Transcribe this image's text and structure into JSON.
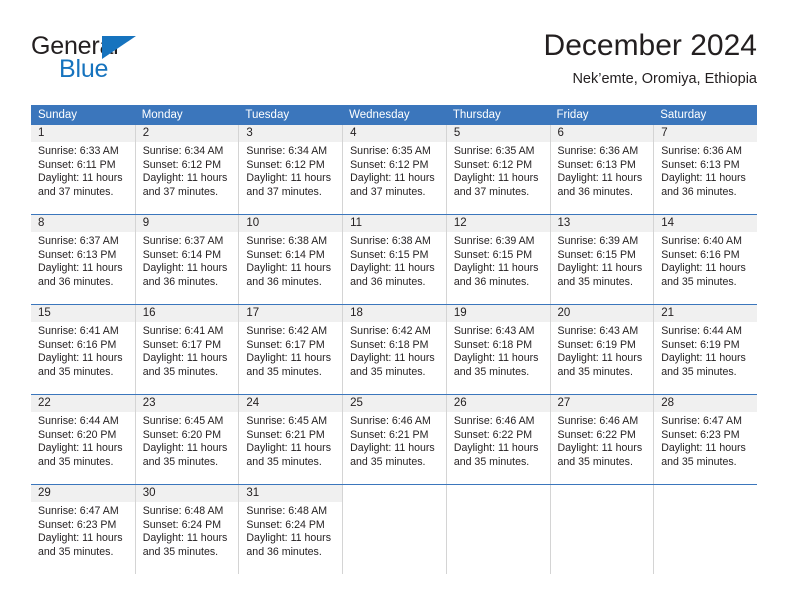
{
  "brand": {
    "name_part1": "General",
    "name_part2": "Blue",
    "triangle_color": "#1673be",
    "text_color": "#231f20"
  },
  "header": {
    "title": "December 2024",
    "subtitle": "Nek’emte, Oromiya, Ethiopia"
  },
  "theme": {
    "header_bg": "#3b76bc",
    "header_text": "#ffffff",
    "daynum_bg": "#f0f0f0",
    "cell_border": "#d4d4d4",
    "text": "#231f20"
  },
  "weekday_headers": [
    "Sunday",
    "Monday",
    "Tuesday",
    "Wednesday",
    "Thursday",
    "Friday",
    "Saturday"
  ],
  "labels": {
    "sunrise_prefix": "Sunrise:",
    "sunset_prefix": "Sunset:",
    "daylight_prefix": "Daylight:"
  },
  "weeks": [
    [
      {
        "day": "1",
        "sunrise": "Sunrise: 6:33 AM",
        "sunset": "Sunset: 6:11 PM",
        "daylight": "Daylight: 11 hours and 37 minutes."
      },
      {
        "day": "2",
        "sunrise": "Sunrise: 6:34 AM",
        "sunset": "Sunset: 6:12 PM",
        "daylight": "Daylight: 11 hours and 37 minutes."
      },
      {
        "day": "3",
        "sunrise": "Sunrise: 6:34 AM",
        "sunset": "Sunset: 6:12 PM",
        "daylight": "Daylight: 11 hours and 37 minutes."
      },
      {
        "day": "4",
        "sunrise": "Sunrise: 6:35 AM",
        "sunset": "Sunset: 6:12 PM",
        "daylight": "Daylight: 11 hours and 37 minutes."
      },
      {
        "day": "5",
        "sunrise": "Sunrise: 6:35 AM",
        "sunset": "Sunset: 6:12 PM",
        "daylight": "Daylight: 11 hours and 37 minutes."
      },
      {
        "day": "6",
        "sunrise": "Sunrise: 6:36 AM",
        "sunset": "Sunset: 6:13 PM",
        "daylight": "Daylight: 11 hours and 36 minutes."
      },
      {
        "day": "7",
        "sunrise": "Sunrise: 6:36 AM",
        "sunset": "Sunset: 6:13 PM",
        "daylight": "Daylight: 11 hours and 36 minutes."
      }
    ],
    [
      {
        "day": "8",
        "sunrise": "Sunrise: 6:37 AM",
        "sunset": "Sunset: 6:13 PM",
        "daylight": "Daylight: 11 hours and 36 minutes."
      },
      {
        "day": "9",
        "sunrise": "Sunrise: 6:37 AM",
        "sunset": "Sunset: 6:14 PM",
        "daylight": "Daylight: 11 hours and 36 minutes."
      },
      {
        "day": "10",
        "sunrise": "Sunrise: 6:38 AM",
        "sunset": "Sunset: 6:14 PM",
        "daylight": "Daylight: 11 hours and 36 minutes."
      },
      {
        "day": "11",
        "sunrise": "Sunrise: 6:38 AM",
        "sunset": "Sunset: 6:15 PM",
        "daylight": "Daylight: 11 hours and 36 minutes."
      },
      {
        "day": "12",
        "sunrise": "Sunrise: 6:39 AM",
        "sunset": "Sunset: 6:15 PM",
        "daylight": "Daylight: 11 hours and 36 minutes."
      },
      {
        "day": "13",
        "sunrise": "Sunrise: 6:39 AM",
        "sunset": "Sunset: 6:15 PM",
        "daylight": "Daylight: 11 hours and 35 minutes."
      },
      {
        "day": "14",
        "sunrise": "Sunrise: 6:40 AM",
        "sunset": "Sunset: 6:16 PM",
        "daylight": "Daylight: 11 hours and 35 minutes."
      }
    ],
    [
      {
        "day": "15",
        "sunrise": "Sunrise: 6:41 AM",
        "sunset": "Sunset: 6:16 PM",
        "daylight": "Daylight: 11 hours and 35 minutes."
      },
      {
        "day": "16",
        "sunrise": "Sunrise: 6:41 AM",
        "sunset": "Sunset: 6:17 PM",
        "daylight": "Daylight: 11 hours and 35 minutes."
      },
      {
        "day": "17",
        "sunrise": "Sunrise: 6:42 AM",
        "sunset": "Sunset: 6:17 PM",
        "daylight": "Daylight: 11 hours and 35 minutes."
      },
      {
        "day": "18",
        "sunrise": "Sunrise: 6:42 AM",
        "sunset": "Sunset: 6:18 PM",
        "daylight": "Daylight: 11 hours and 35 minutes."
      },
      {
        "day": "19",
        "sunrise": "Sunrise: 6:43 AM",
        "sunset": "Sunset: 6:18 PM",
        "daylight": "Daylight: 11 hours and 35 minutes."
      },
      {
        "day": "20",
        "sunrise": "Sunrise: 6:43 AM",
        "sunset": "Sunset: 6:19 PM",
        "daylight": "Daylight: 11 hours and 35 minutes."
      },
      {
        "day": "21",
        "sunrise": "Sunrise: 6:44 AM",
        "sunset": "Sunset: 6:19 PM",
        "daylight": "Daylight: 11 hours and 35 minutes."
      }
    ],
    [
      {
        "day": "22",
        "sunrise": "Sunrise: 6:44 AM",
        "sunset": "Sunset: 6:20 PM",
        "daylight": "Daylight: 11 hours and 35 minutes."
      },
      {
        "day": "23",
        "sunrise": "Sunrise: 6:45 AM",
        "sunset": "Sunset: 6:20 PM",
        "daylight": "Daylight: 11 hours and 35 minutes."
      },
      {
        "day": "24",
        "sunrise": "Sunrise: 6:45 AM",
        "sunset": "Sunset: 6:21 PM",
        "daylight": "Daylight: 11 hours and 35 minutes."
      },
      {
        "day": "25",
        "sunrise": "Sunrise: 6:46 AM",
        "sunset": "Sunset: 6:21 PM",
        "daylight": "Daylight: 11 hours and 35 minutes."
      },
      {
        "day": "26",
        "sunrise": "Sunrise: 6:46 AM",
        "sunset": "Sunset: 6:22 PM",
        "daylight": "Daylight: 11 hours and 35 minutes."
      },
      {
        "day": "27",
        "sunrise": "Sunrise: 6:46 AM",
        "sunset": "Sunset: 6:22 PM",
        "daylight": "Daylight: 11 hours and 35 minutes."
      },
      {
        "day": "28",
        "sunrise": "Sunrise: 6:47 AM",
        "sunset": "Sunset: 6:23 PM",
        "daylight": "Daylight: 11 hours and 35 minutes."
      }
    ],
    [
      {
        "day": "29",
        "sunrise": "Sunrise: 6:47 AM",
        "sunset": "Sunset: 6:23 PM",
        "daylight": "Daylight: 11 hours and 35 minutes."
      },
      {
        "day": "30",
        "sunrise": "Sunrise: 6:48 AM",
        "sunset": "Sunset: 6:24 PM",
        "daylight": "Daylight: 11 hours and 35 minutes."
      },
      {
        "day": "31",
        "sunrise": "Sunrise: 6:48 AM",
        "sunset": "Sunset: 6:24 PM",
        "daylight": "Daylight: 11 hours and 36 minutes."
      },
      {
        "day": "",
        "sunrise": "",
        "sunset": "",
        "daylight": ""
      },
      {
        "day": "",
        "sunrise": "",
        "sunset": "",
        "daylight": ""
      },
      {
        "day": "",
        "sunrise": "",
        "sunset": "",
        "daylight": ""
      },
      {
        "day": "",
        "sunrise": "",
        "sunset": "",
        "daylight": ""
      }
    ]
  ]
}
